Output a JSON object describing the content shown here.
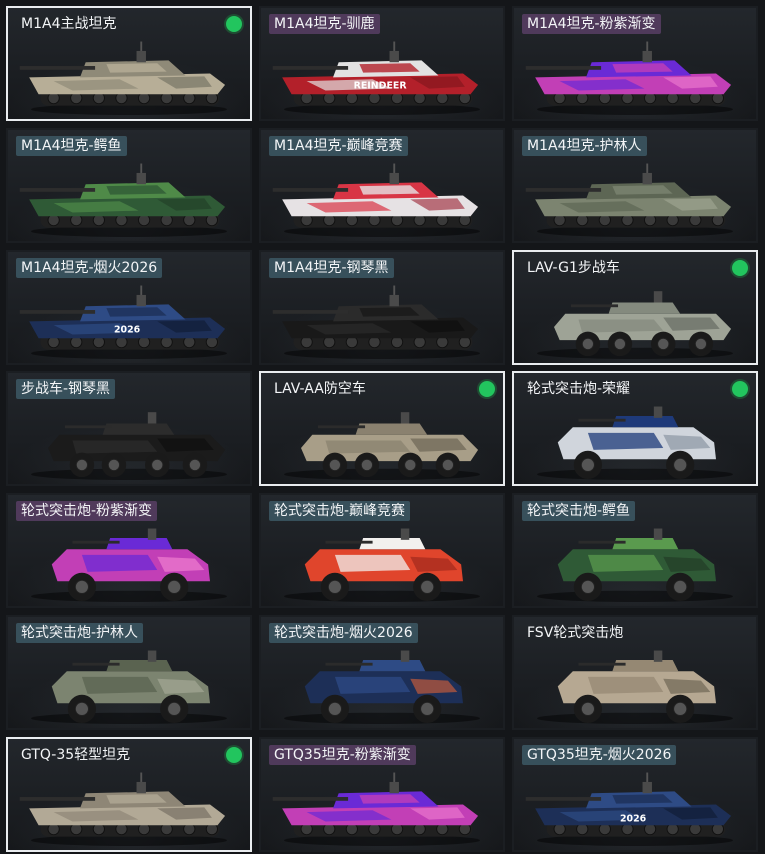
{
  "colors": {
    "badge": "#22c55e",
    "selected_border": "#e9ecef"
  },
  "vehicles": [
    {
      "name": "M1A4主战坦克",
      "type": "tank",
      "selected": true,
      "equipped": true,
      "label_style": "none",
      "paint": [
        "#b7ae97",
        "#8f8a78",
        "#6d6a5e"
      ]
    },
    {
      "name": "M1A4坦克-驯鹿",
      "type": "tank",
      "selected": false,
      "equipped": false,
      "label_style": "purple",
      "paint": [
        "#b3202a",
        "#e2e2e2",
        "#7d151c"
      ],
      "decal": "REINDEER"
    },
    {
      "name": "M1A4坦克-粉紫渐变",
      "type": "tank",
      "selected": false,
      "equipped": false,
      "label_style": "purple",
      "paint": [
        "#c23fb6",
        "#6a2ad6",
        "#f07fd0"
      ]
    },
    {
      "name": "M1A4坦克-鳄鱼",
      "type": "tank",
      "selected": false,
      "equipped": false,
      "label_style": "teal",
      "paint": [
        "#2f5a36",
        "#4f8a48",
        "#223c26"
      ]
    },
    {
      "name": "M1A4坦克-巅峰竞赛",
      "type": "tank",
      "selected": false,
      "equipped": false,
      "label_style": "teal",
      "paint": [
        "#e6e2e4",
        "#d83545",
        "#9a2030"
      ]
    },
    {
      "name": "M1A4坦克-护林人",
      "type": "tank",
      "selected": false,
      "equipped": false,
      "label_style": "teal",
      "paint": [
        "#7c8470",
        "#5d6654",
        "#a4a895"
      ]
    },
    {
      "name": "M1A4坦克-烟火2026",
      "type": "tank",
      "selected": false,
      "equipped": false,
      "label_style": "teal",
      "paint": [
        "#1d2f57",
        "#2e4b85",
        "#0f1a30"
      ],
      "decal": "2026"
    },
    {
      "name": "M1A4坦克-钢琴黑",
      "type": "tank",
      "selected": false,
      "equipped": false,
      "label_style": "teal",
      "paint": [
        "#191919",
        "#2b2b2b",
        "#0c0c0c"
      ]
    },
    {
      "name": "LAV-G1步战车",
      "type": "ifv",
      "selected": true,
      "equipped": true,
      "label_style": "none",
      "paint": [
        "#9ea396",
        "#848a7e",
        "#666b62"
      ]
    },
    {
      "name": "步战车-钢琴黑",
      "type": "ifv",
      "selected": false,
      "equipped": false,
      "label_style": "teal",
      "paint": [
        "#1b1b1b",
        "#2c2c2c",
        "#0e0e0e"
      ]
    },
    {
      "name": "LAV-AA防空车",
      "type": "ifv",
      "selected": true,
      "equipped": true,
      "label_style": "none",
      "paint": [
        "#a89e88",
        "#8a816f",
        "#6c6556"
      ]
    },
    {
      "name": "轮式突击炮-荣耀",
      "type": "assault",
      "selected": true,
      "equipped": true,
      "label_style": "none",
      "paint": [
        "#d0d5dc",
        "#1e3a7a",
        "#8c96a3"
      ]
    },
    {
      "name": "轮式突击炮-粉紫渐变",
      "type": "assault",
      "selected": false,
      "equipped": false,
      "label_style": "purple",
      "paint": [
        "#c23fb6",
        "#6a2ad6",
        "#f07fd0"
      ]
    },
    {
      "name": "轮式突击炮-巅峰竞赛",
      "type": "assault",
      "selected": false,
      "equipped": false,
      "label_style": "teal",
      "paint": [
        "#e0452c",
        "#f2f0ee",
        "#a12a1c"
      ]
    },
    {
      "name": "轮式突击炮-鳄鱼",
      "type": "assault",
      "selected": false,
      "equipped": false,
      "label_style": "teal",
      "paint": [
        "#2f5a36",
        "#5a9a4e",
        "#223c26"
      ]
    },
    {
      "name": "轮式突击炮-护林人",
      "type": "assault",
      "selected": false,
      "equipped": false,
      "label_style": "teal",
      "paint": [
        "#7c8470",
        "#5a6350",
        "#a4a895"
      ]
    },
    {
      "name": "轮式突击炮-烟火2026",
      "type": "assault",
      "selected": false,
      "equipped": false,
      "label_style": "teal",
      "paint": [
        "#1d2f57",
        "#2e4b85",
        "#c25a3a"
      ]
    },
    {
      "name": "FSV轮式突击炮",
      "type": "assault",
      "selected": false,
      "equipped": false,
      "label_style": "none",
      "paint": [
        "#b6a892",
        "#958873",
        "#6f6656"
      ]
    },
    {
      "name": "GTQ-35轻型坦克",
      "type": "light",
      "selected": true,
      "equipped": true,
      "label_style": "none",
      "paint": [
        "#b2a996",
        "#8e8676",
        "#6e685b"
      ]
    },
    {
      "name": "GTQ35坦克-粉紫渐变",
      "type": "light",
      "selected": false,
      "equipped": false,
      "label_style": "purple",
      "paint": [
        "#c23fb6",
        "#6a2ad6",
        "#f07fd0"
      ]
    },
    {
      "name": "GTQ35坦克-烟火2026",
      "type": "light",
      "selected": false,
      "equipped": false,
      "label_style": "teal",
      "paint": [
        "#1d2f57",
        "#2e4b85",
        "#0f1a30"
      ],
      "decal": "2026"
    }
  ]
}
